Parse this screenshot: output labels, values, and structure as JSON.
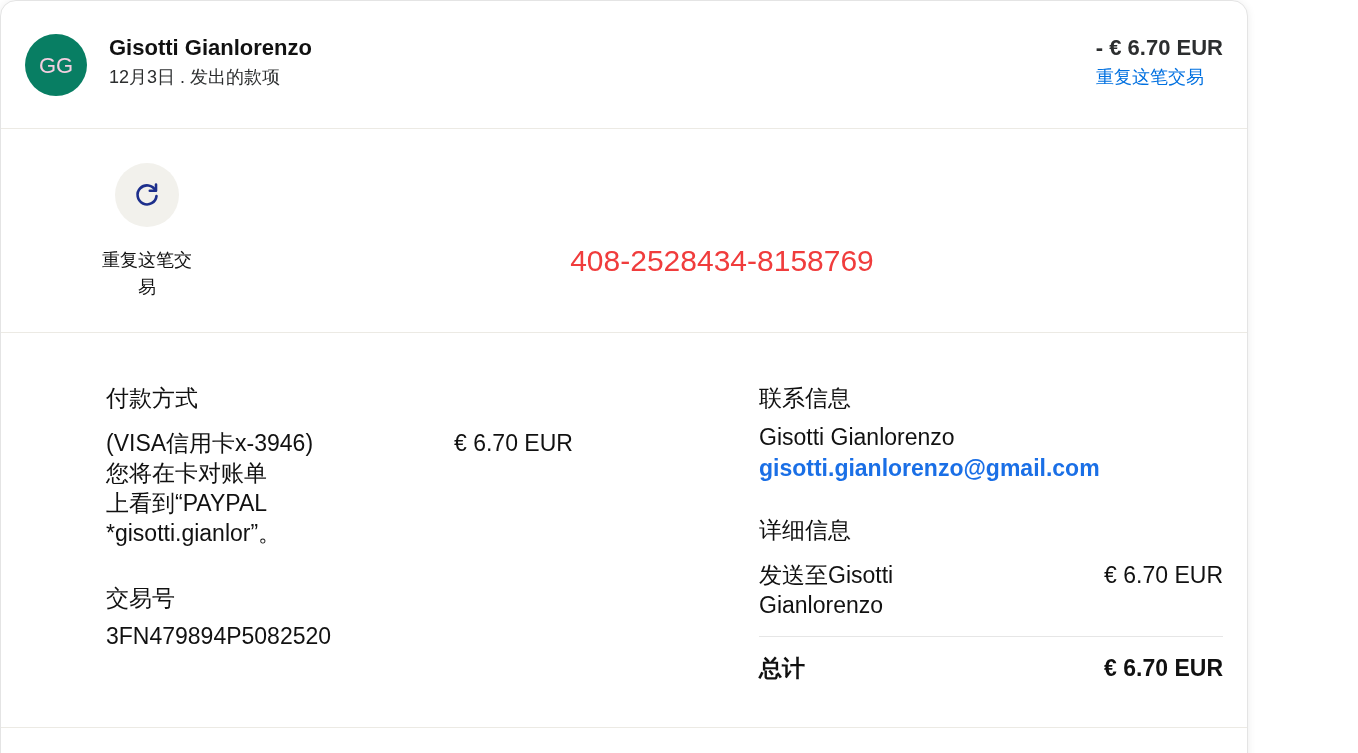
{
  "transaction_header": {
    "avatar_initials": "GG",
    "name": "Gisotti Gianlorenzo",
    "subtitle": "12月3日 . 发出的款项",
    "amount": "- € 6.70 EUR",
    "repeat_link": "重复这笔交易"
  },
  "actions": [
    {
      "kind": "repeat",
      "label": "重复这笔交易"
    }
  ],
  "annotation": "408-2528434-8158769",
  "payment_method": {
    "heading": "付款方式",
    "card": "(VISA信用卡x-3946)",
    "statement_note": "您将在卡对账单上看到“PAYPAL *gisotti.gianlor”。",
    "amount": "€ 6.70 EUR"
  },
  "transaction_id": {
    "heading": "交易号",
    "value": "3FN479894P5082520"
  },
  "contact": {
    "heading": "联系信息",
    "name": "Gisotti Gianlorenzo",
    "email": "gisotti.gianlorenzo@gmail.com"
  },
  "details": {
    "heading": "详细信息",
    "items": [
      {
        "label": "发送至Gisotti Gianlorenzo",
        "amount": "€ 6.70 EUR"
      }
    ],
    "total": {
      "label": "总计",
      "amount": "€ 6.70 EUR"
    }
  }
}
